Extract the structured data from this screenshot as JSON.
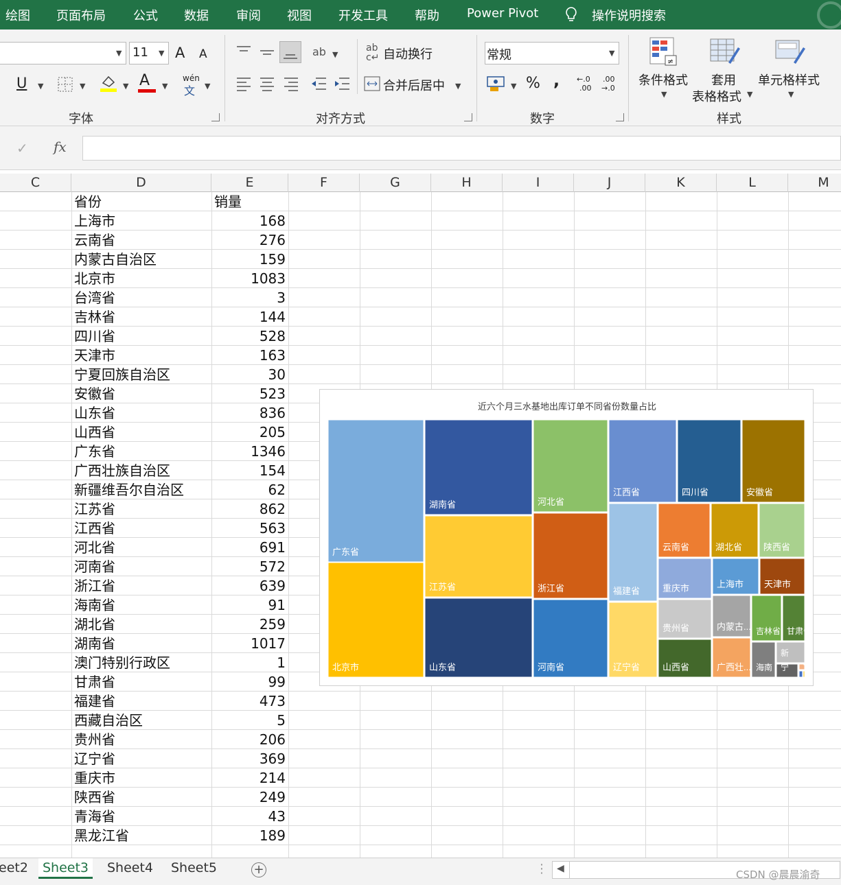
{
  "menu": [
    "绘图",
    "页面布局",
    "公式",
    "数据",
    "审阅",
    "视图",
    "开发工具",
    "帮助",
    "Power Pivot",
    "操作说明搜索"
  ],
  "ribbon": {
    "font_size": "11",
    "grow_font": "A",
    "shrink_font": "A",
    "underline": "U",
    "font_color_glyph": "A",
    "phonetic_top": "wén",
    "phonetic_bottom": "文",
    "wrap_text": "自动换行",
    "merge_center": "合并后居中",
    "number_format": "常规",
    "percent": "%",
    "comma": ",",
    "inc_decimal_top": "←.0",
    "inc_decimal_bottom": ".00",
    "dec_decimal_top": ".00",
    "dec_decimal_bottom": "→.0",
    "cond_format": "条件格式",
    "table_format_1": "套用",
    "table_format_2": "表格格式",
    "cell_styles": "单元格样式",
    "groups": {
      "font": "字体",
      "align": "对齐方式",
      "number": "数字",
      "styles": "样式"
    }
  },
  "formula_bar": {
    "fx": "fx",
    "check": "✓",
    "value": ""
  },
  "columns": [
    "C",
    "D",
    "E",
    "F",
    "G",
    "H",
    "I",
    "J",
    "K",
    "L",
    "M"
  ],
  "table": {
    "headers": [
      "省份",
      "销量"
    ],
    "rows": [
      [
        "上海市",
        "168"
      ],
      [
        "云南省",
        "276"
      ],
      [
        "内蒙古自治区",
        "159"
      ],
      [
        "北京市",
        "1083"
      ],
      [
        "台湾省",
        "3"
      ],
      [
        "吉林省",
        "144"
      ],
      [
        "四川省",
        "528"
      ],
      [
        "天津市",
        "163"
      ],
      [
        "宁夏回族自治区",
        "30"
      ],
      [
        "安徽省",
        "523"
      ],
      [
        "山东省",
        "836"
      ],
      [
        "山西省",
        "205"
      ],
      [
        "广东省",
        "1346"
      ],
      [
        "广西壮族自治区",
        "154"
      ],
      [
        "新疆维吾尔自治区",
        "62"
      ],
      [
        "江苏省",
        "862"
      ],
      [
        "江西省",
        "563"
      ],
      [
        "河北省",
        "691"
      ],
      [
        "河南省",
        "572"
      ],
      [
        "浙江省",
        "639"
      ],
      [
        "海南省",
        "91"
      ],
      [
        "湖北省",
        "259"
      ],
      [
        "湖南省",
        "1017"
      ],
      [
        "澳门特别行政区",
        "1"
      ],
      [
        "甘肃省",
        "99"
      ],
      [
        "福建省",
        "473"
      ],
      [
        "西藏自治区",
        "5"
      ],
      [
        "贵州省",
        "206"
      ],
      [
        "辽宁省",
        "369"
      ],
      [
        "重庆市",
        "214"
      ],
      [
        "陕西省",
        "249"
      ],
      [
        "青海省",
        "43"
      ],
      [
        "黑龙江省",
        "189"
      ]
    ]
  },
  "chart_data": {
    "type": "treemap",
    "title": "近六个月三水基地出库订单不同省份数量占比",
    "items": [
      {
        "label": "广东省",
        "value": 1346,
        "color": "#7aacdc"
      },
      {
        "label": "北京市",
        "value": 1083,
        "color": "#ffc000"
      },
      {
        "label": "湖南省",
        "value": 1017,
        "color": "#3358a0"
      },
      {
        "label": "江苏省",
        "value": 862,
        "color": "#ffcb33"
      },
      {
        "label": "山东省",
        "value": 836,
        "color": "#264478"
      },
      {
        "label": "河北省",
        "value": 691,
        "color": "#8cc168"
      },
      {
        "label": "浙江省",
        "value": 639,
        "color": "#d05e15"
      },
      {
        "label": "河南省",
        "value": 572,
        "color": "#327bc2"
      },
      {
        "label": "江西省",
        "value": 563,
        "color": "#698ed0"
      },
      {
        "label": "四川省",
        "value": 528,
        "color": "#255e91"
      },
      {
        "label": "安徽省",
        "value": 523,
        "color": "#9c7200"
      },
      {
        "label": "福建省",
        "value": 473,
        "color": "#9dc3e6"
      },
      {
        "label": "辽宁省",
        "value": 369,
        "color": "#ffd966"
      },
      {
        "label": "云南省",
        "value": 276,
        "color": "#ed7d31"
      },
      {
        "label": "湖北省",
        "value": 259,
        "color": "#cc9a06"
      },
      {
        "label": "陕西省",
        "value": 249,
        "color": "#a9d18e"
      },
      {
        "label": "重庆市",
        "value": 214,
        "color": "#8faadc"
      },
      {
        "label": "上海市",
        "value": 168,
        "color": "#5b9bd5"
      },
      {
        "label": "天津市",
        "value": 163,
        "color": "#9e480e"
      },
      {
        "label": "贵州省",
        "value": 206,
        "color": "#c9c9c9"
      },
      {
        "label": "内蒙古...",
        "value": 159,
        "color": "#a5a5a5"
      },
      {
        "label": "吉林省",
        "value": 144,
        "color": "#70ad47"
      },
      {
        "label": "甘肃省",
        "value": 99,
        "color": "#548235"
      },
      {
        "label": "山西省",
        "value": 205,
        "color": "#43682b"
      },
      {
        "label": "广西壮...",
        "value": 154,
        "color": "#f4a460"
      },
      {
        "label": "海南",
        "value": 91,
        "color": "#7f7f7f"
      },
      {
        "label": "新",
        "value": 62,
        "color": "#bfbfbf"
      },
      {
        "label": "宁",
        "value": 30,
        "color": "#636363"
      },
      {
        "label": "",
        "value": 43,
        "color": "#f4b183"
      },
      {
        "label": "",
        "value": 5,
        "color": "#4472c4"
      },
      {
        "label": "",
        "value": 3,
        "color": "#ffc000"
      },
      {
        "label": "",
        "value": 1,
        "color": "#70ad47"
      }
    ]
  },
  "sheets": [
    "eet2",
    "Sheet3",
    "Sheet4",
    "Sheet5"
  ],
  "active_sheet": "Sheet3",
  "add_sheet": "+",
  "watermark": "CSDN @晨晨渝奇"
}
